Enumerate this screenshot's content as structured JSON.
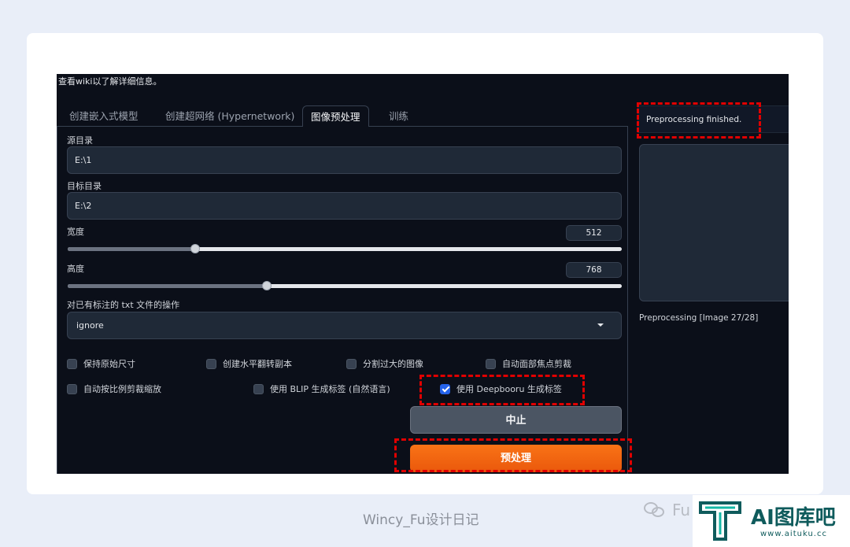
{
  "page": {
    "header_text": "查看wiki以了解详细信息。",
    "tabs": [
      {
        "label": "创建嵌入式模型"
      },
      {
        "label": "创建超网络 (Hypernetwork)"
      },
      {
        "label": "图像预处理"
      },
      {
        "label": "训练"
      }
    ],
    "source_dir": {
      "label": "源目录",
      "value": "E:\\1"
    },
    "target_dir": {
      "label": "目标目录",
      "value": "E:\\2"
    },
    "width": {
      "label": "宽度",
      "value": "512",
      "fraction": 0.23
    },
    "height": {
      "label": "高度",
      "value": "768",
      "fraction": 0.36
    },
    "existing_txt": {
      "label": "对已有标注的 txt 文件的操作",
      "value": "ignore"
    },
    "options": [
      {
        "label": "保持原始尺寸",
        "checked": false
      },
      {
        "label": "创建水平翻转副本",
        "checked": false
      },
      {
        "label": "分割过大的图像",
        "checked": false
      },
      {
        "label": "自动面部焦点剪裁",
        "checked": false
      },
      {
        "label": "自动按比例剪裁缩放",
        "checked": false
      },
      {
        "label": "使用 BLIP 生成标签 (自然语言)",
        "checked": false
      },
      {
        "label": "使用 Deepbooru 生成标签",
        "checked": true
      }
    ],
    "interrupt_button": "中止",
    "preprocess_button": "预处理",
    "output_message": "Preprocessing finished.",
    "progress_status": "Preprocessing [Image 27/28]"
  },
  "caption": "Wincy_Fu设计日记",
  "watermark": {
    "account": "Fu",
    "brand": "AI图库吧",
    "url": "www.aituku.cc"
  },
  "colors": {
    "accent_orange": "#f97316",
    "highlight_red": "#e00000",
    "brand_teal": "#0f5b5c"
  }
}
